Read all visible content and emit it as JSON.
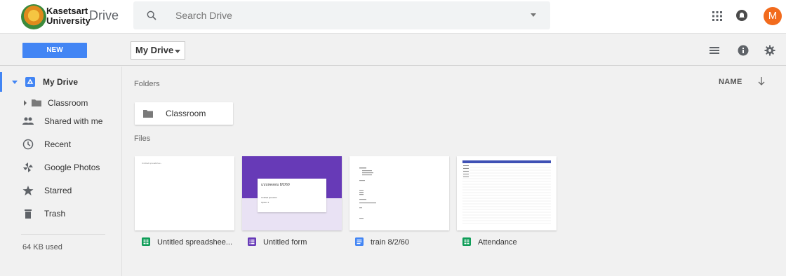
{
  "header": {
    "org_name": "Kasetsart University",
    "org_line1": "Kasetsart",
    "org_line2": "University",
    "app_name": "Drive",
    "search_placeholder": "Search Drive",
    "avatar_initial": "M"
  },
  "toolbar": {
    "new_label": "NEW",
    "location_label": "My Drive"
  },
  "sidebar": {
    "items": [
      {
        "label": "My Drive",
        "icon": "drive-icon",
        "active": true
      },
      {
        "label": "Classroom",
        "icon": "folder-icon"
      },
      {
        "label": "Shared with me",
        "icon": "people-icon"
      },
      {
        "label": "Recent",
        "icon": "clock-icon"
      },
      {
        "label": "Google Photos",
        "icon": "pinwheel-icon"
      },
      {
        "label": "Starred",
        "icon": "star-icon"
      },
      {
        "label": "Trash",
        "icon": "trash-icon"
      }
    ],
    "storage": "64 KB used"
  },
  "main": {
    "folders_title": "Folders",
    "files_title": "Files",
    "sort_label": "NAME",
    "folders": [
      {
        "name": "Classroom"
      }
    ],
    "files": [
      {
        "name": "Untitled spreadshee...",
        "type": "sheet",
        "type_color": "#0f9d58"
      },
      {
        "name": "Untitled form",
        "type": "form",
        "type_color": "#673ab7"
      },
      {
        "name": "train 8/2/60",
        "type": "doc",
        "type_color": "#4285f4"
      },
      {
        "name": "Attendance",
        "type": "sheet",
        "type_color": "#0f9d58"
      }
    ],
    "form_thumb": {
      "title": "แบบทดสอบ 8/2/60",
      "question": "Untitled Question",
      "option": "Option 1"
    }
  },
  "colors": {
    "accent": "#4285f4",
    "avatar": "#f26b1d",
    "form_purple": "#673ab7"
  }
}
